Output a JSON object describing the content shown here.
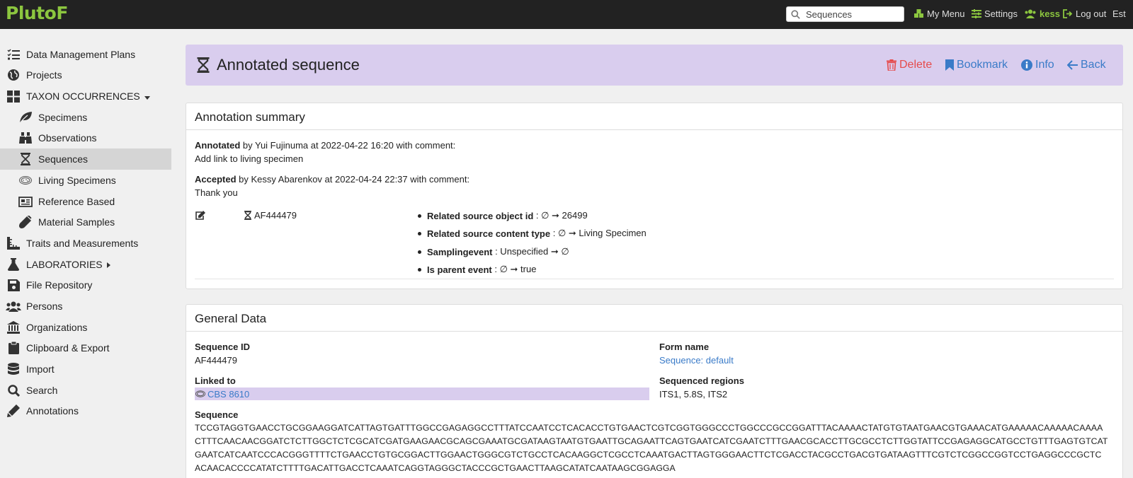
{
  "topbar": {
    "logo": "PlutoF",
    "search_placeholder": "Sequences",
    "my_menu": "My Menu",
    "settings": "Settings",
    "user": "kess",
    "logout": "Log out",
    "language": "Est"
  },
  "sidebar": {
    "items": [
      {
        "label": "Data Management Plans",
        "icon": "checklist-icon"
      },
      {
        "label": "Projects",
        "icon": "globe-icon"
      },
      {
        "label": "TAXON OCCURRENCES",
        "icon": "grid-icon"
      },
      {
        "label": "Specimens",
        "icon": "leaf-icon"
      },
      {
        "label": "Observations",
        "icon": "binoculars-icon"
      },
      {
        "label": "Sequences",
        "icon": "hourglass-icon"
      },
      {
        "label": "Living Specimens",
        "icon": "petri-dish-icon"
      },
      {
        "label": "Reference Based",
        "icon": "newspaper-icon"
      },
      {
        "label": "Material Samples",
        "icon": "test-tube-icon"
      },
      {
        "label": "Traits and Measurements",
        "icon": "ruler-icon"
      },
      {
        "label": "LABORATORIES",
        "icon": "flask-icon"
      },
      {
        "label": "File Repository",
        "icon": "floppy-icon"
      },
      {
        "label": "Persons",
        "icon": "users-icon"
      },
      {
        "label": "Organizations",
        "icon": "building-icon"
      },
      {
        "label": "Clipboard & Export",
        "icon": "clipboard-icon"
      },
      {
        "label": "Import",
        "icon": "database-icon"
      },
      {
        "label": "Search",
        "icon": "search-icon"
      },
      {
        "label": "Annotations",
        "icon": "pen-icon"
      }
    ]
  },
  "header": {
    "title": "Annotated sequence",
    "delete": "Delete",
    "bookmark": "Bookmark",
    "info": "Info",
    "back": "Back"
  },
  "annotation": {
    "title": "Annotation summary",
    "annotated_label": "Annotated",
    "annotated_text": " by Yui Fujinuma at 2022-04-22 16:20 with comment:",
    "annotated_comment": "Add link to living specimen",
    "accepted_label": "Accepted",
    "accepted_text": " by Kessy Abarenkov at 2022-04-24 22:37 with comment:",
    "accepted_comment": "Thank you",
    "record_id": "AF444479",
    "changes": [
      {
        "field": "Related source object id",
        "value": " : ∅ ➞ 26499"
      },
      {
        "field": "Related source content type",
        "value": " : ∅ ➞ Living Specimen"
      },
      {
        "field": "Samplingevent",
        "value": " : Unspecified ➞ ∅"
      },
      {
        "field": "Is parent event",
        "value": " : ∅ ➞ true"
      }
    ]
  },
  "general": {
    "title": "General Data",
    "sequence_id_label": "Sequence ID",
    "sequence_id": "AF444479",
    "form_name_label": "Form name",
    "form_name": "Sequence: default",
    "linked_to_label": "Linked to",
    "linked_to": "CBS 8610",
    "sequenced_regions_label": "Sequenced regions",
    "sequenced_regions": "ITS1, 5.8S, ITS2",
    "sequence_label": "Sequence",
    "sequence_lines": [
      "TCCGTAGGTGAACCTGCGGAAGGATCATTAGTGATTTGGCCGAGAGGCCTTTATCCAATCCTCACACCTGTGAACTCGTCGGTGGGCCCTGGCCCGCCGGATTTACAAAACTATGTGTAATGAACGTGAAACATGAAAAACAAAAACAAAA",
      "CTTTCAACAACGGATCTCTTGGCTCTCGCATCGATGAAGAACGCAGCGAAATGCGATAAGTAATGTGAATTGCAGAATTCAGTGAATCATCGAATCTTTGAACGCACCTTGCGCCTCTTGGTATTCCGAGAGGCATGCCTGTTTGAGTGTCAT",
      "GAATCATCAATCCCACGGGTTTTCTGAACCTGTGCGGACTTGGAACTGGGCGTCTGCCTCACAAGGCTCGCCTCAAATGACTTAGTGGGAACTTCTCGACCTACGCCTGACGTGATAAGTTTCGTCTCGGCCGGTCCTGAGGCCCGCTC",
      "ACAACACCCCATATCTTTTGACATTGACCTCAAATCAGGTAGGGCTACCCGCTGAACTTAAGCATATCAATAAGCGGAGGA"
    ]
  }
}
